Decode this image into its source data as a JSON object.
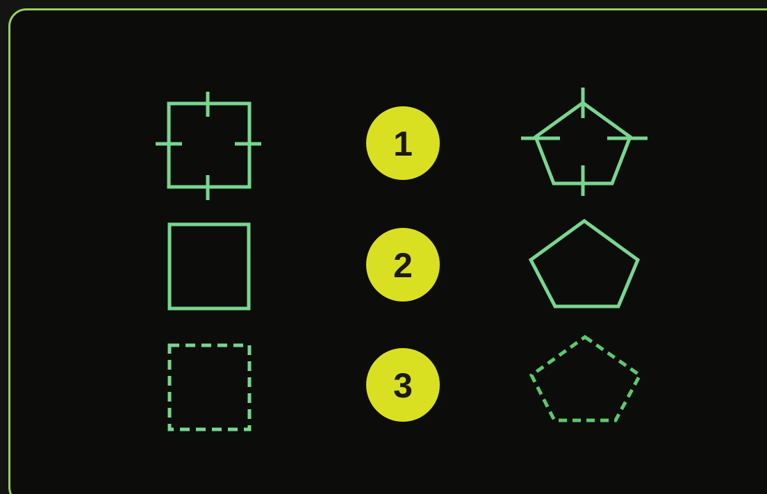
{
  "options": [
    {
      "number": "1",
      "style": "with-crosshair-markers"
    },
    {
      "number": "2",
      "style": "solid-outline"
    },
    {
      "number": "3",
      "style": "dashed-outline"
    }
  ],
  "shapes": {
    "left": "square",
    "right": "pentagon"
  },
  "colors": {
    "background": "#0c0d0b",
    "frame": "#9ad05c",
    "shape_stroke": "#78d68f",
    "badge_fill": "#d9e021",
    "badge_text": "#1a1a14"
  }
}
